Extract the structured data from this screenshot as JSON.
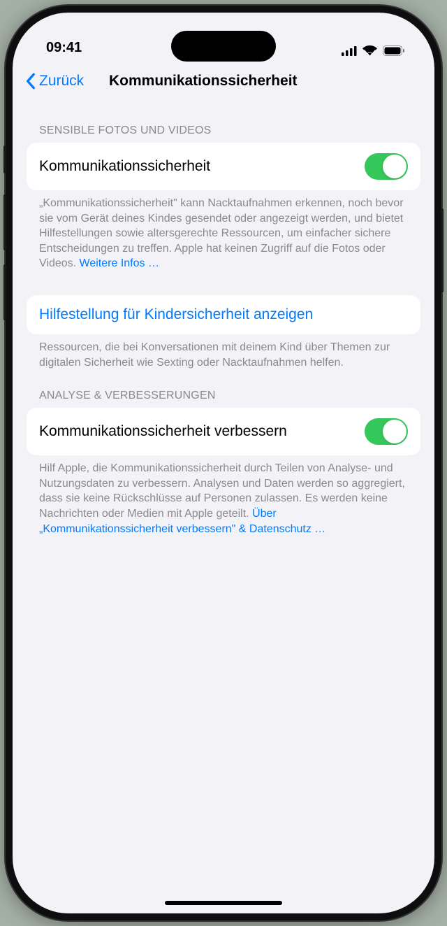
{
  "status": {
    "time": "09:41"
  },
  "nav": {
    "back": "Zurück",
    "title": "Kommunikationssicherheit"
  },
  "section1": {
    "header": "SENSIBLE FOTOS UND VIDEOS",
    "toggle_label": "Kommunikationssicherheit",
    "footer_text": "„Kommunikationssicherheit\" kann Nacktaufnahmen erkennen, noch bevor sie vom Gerät deines Kindes gesendet oder angezeigt werden, und bietet Hilfestel­lungen sowie altersgerechte Ressourcen, um einfacher sichere Entscheidungen zu treffen. Apple hat keinen Zugriff auf die Fotos oder Videos. ",
    "footer_link": "Weitere Infos …"
  },
  "section2": {
    "link_label": "Hilfestellung für Kindersicherheit anzeigen",
    "footer_text": "Ressourcen, die bei Konversationen mit deinem Kind über Themen zur digitalen Sicherheit wie Sexting oder Nacktaufnahmen helfen."
  },
  "section3": {
    "header": "ANALYSE & VERBESSERUNGEN",
    "toggle_label": "Kommunikationssicherheit verbessern",
    "footer_text": "Hilf Apple, die Kommunikationssicherheit durch Teilen von Analyse- und Nutzungsdaten zu verbessern. Analysen und Daten werden so aggregiert, dass sie keine Rückschlüsse auf Personen zulassen. Es werden keine Nachrichten oder Medien mit Apple geteilt. ",
    "footer_link": "Über „Kommunikationssicherheit verbessern\" & Daten­schutz …"
  }
}
